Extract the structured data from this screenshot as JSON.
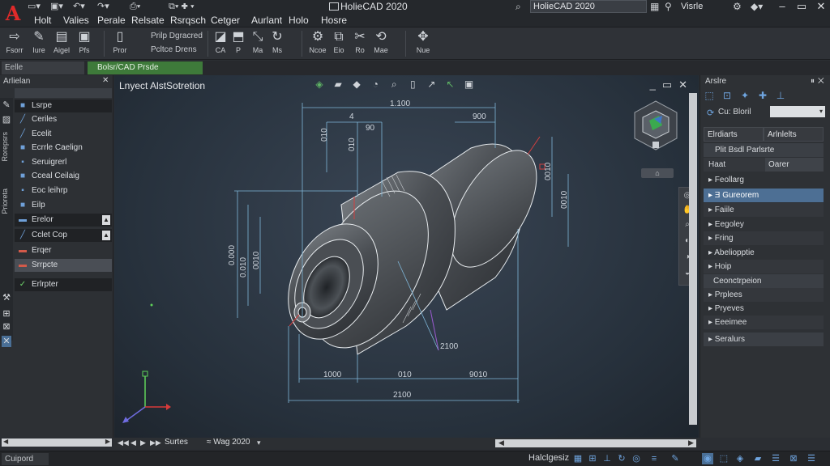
{
  "titlebar": {
    "window_title": "HolieCAD 2020",
    "search_value": "HolieCAD 2020",
    "account_label": "Visrle"
  },
  "menu": [
    "Holt",
    "Valies",
    "Perale",
    "Relsate",
    "Rsrqsch",
    "Cetger",
    "Aurlant",
    "Holo",
    "Hosre"
  ],
  "ribbon": {
    "buttons": [
      {
        "icon": "arrow-right-icon",
        "glyph": "⇨",
        "label": "Fsorr"
      },
      {
        "icon": "brush-icon",
        "glyph": "✎",
        "label": "Iure"
      },
      {
        "icon": "document-icon",
        "glyph": "▤",
        "label": "Aigel"
      },
      {
        "icon": "image-icon",
        "glyph": "▣",
        "label": "Pfs"
      },
      {
        "icon": "new-file-icon",
        "glyph": "▯",
        "label": "Pror"
      },
      {
        "icon": "shape-icon",
        "glyph": "◪",
        "label": "CA"
      },
      {
        "icon": "bookmark-icon",
        "glyph": "⬒",
        "label": "P"
      },
      {
        "icon": "arrows-icon",
        "glyph": "⤡",
        "label": "Ma"
      },
      {
        "icon": "rotate-icon",
        "glyph": "↻",
        "label": "Ms"
      },
      {
        "icon": "gear-icon",
        "glyph": "⚙",
        "label": "Ncoe"
      },
      {
        "icon": "copy-icon",
        "glyph": "⧉",
        "label": "Eio"
      },
      {
        "icon": "cut-icon",
        "glyph": "✂",
        "label": "Ro"
      },
      {
        "icon": "refresh-icon",
        "glyph": "⟲",
        "label": "Mae"
      },
      {
        "icon": "cursor-icon",
        "glyph": "✥",
        "label": "Nue"
      }
    ],
    "text_group_1": "Prilp Dgracred",
    "text_group_2": "Pcltce Drens"
  },
  "tabs": {
    "search": "Eelle",
    "document": "Bolsr/CAD Prsde"
  },
  "left_panel": {
    "title": "Arlielan",
    "vtab_1": "Rorepsrs",
    "vtab_2": "Prioreta",
    "items": [
      {
        "label": "Lsrpe",
        "icon": "line-icon",
        "glyph": "■",
        "style": "dark"
      },
      {
        "label": "Ceriles",
        "icon": "pen-icon",
        "glyph": "╱",
        "style": ""
      },
      {
        "label": "Ecelit",
        "icon": "pen-icon",
        "glyph": "╱",
        "style": ""
      },
      {
        "label": "Ecrrle Caelign",
        "icon": "square-icon",
        "glyph": "■",
        "style": ""
      },
      {
        "label": "Seruigrerl",
        "icon": "square-icon",
        "glyph": "▪",
        "style": ""
      },
      {
        "label": "Cceal Ceilaig",
        "icon": "square-icon",
        "glyph": "■",
        "style": ""
      },
      {
        "label": "Eoc leihrp",
        "icon": "square-icon",
        "glyph": "▪",
        "style": ""
      },
      {
        "label": "Eilp",
        "icon": "square-icon",
        "glyph": "■",
        "style": ""
      },
      {
        "label": "Erelor",
        "icon": "line-icon",
        "glyph": "▬",
        "style": "dark",
        "arrow": "▲"
      },
      {
        "label": "Cclet Cop",
        "icon": "pen-icon",
        "glyph": "╱",
        "style": "dark",
        "arrow": "▲"
      },
      {
        "label": "Erqer",
        "icon": "line-icon",
        "glyph": "▬",
        "style": ""
      },
      {
        "label": "Srrpcte",
        "icon": "line-icon",
        "glyph": "▬",
        "style": "sel"
      },
      {
        "label": "Erlrpter",
        "icon": "check-icon",
        "glyph": "✓",
        "style": "dark"
      }
    ]
  },
  "viewport": {
    "label": "Lnyect AlstSotretion",
    "dims": {
      "top_overall": "1.100",
      "left_small": "4",
      "gap_90": "90",
      "right_top": "900",
      "v_left_1": "010",
      "v_left_2": "010",
      "v_right_1": "0010",
      "v_right_2": "0010",
      "v_far_1": "0.000",
      "v_far_2": "0.010",
      "v_far_3": "0010",
      "b_1": "1000",
      "b_2": "010",
      "b_3": "9010",
      "b_total": "2100",
      "diag": "2100"
    },
    "viewcube_home": "⌂"
  },
  "bottombar": {
    "layout_label": "Surtes",
    "model_label": "≈ Wag 2020"
  },
  "right_panel": {
    "title": "Arslre",
    "combo_label": "Cu: Bloril",
    "tab_1": "Elrdiarts",
    "tab_2": "Arlnlelts",
    "rows": [
      {
        "label": "Plit Bsdl Parlsrte",
        "style": "hdr"
      },
      {
        "label": "Haat",
        "style": "alt",
        "value": "Oarer"
      },
      {
        "label": "▸ Feollarg",
        "style": ""
      },
      {
        "label": "▸ Ǝ Gureorem",
        "style": "sel"
      },
      {
        "label": "▸ Faiile",
        "style": "alt"
      },
      {
        "label": "▸ Eegoley",
        "style": ""
      },
      {
        "label": "▸ Fring",
        "style": "alt"
      },
      {
        "label": "▸ Abeliopptie",
        "style": ""
      },
      {
        "label": "▸ Hoip",
        "style": "alt"
      },
      {
        "label": "Ceonctrpeion",
        "style": "hdr"
      },
      {
        "label": "▸ Prplees",
        "style": "alt"
      },
      {
        "label": "▸ Pryeves",
        "style": ""
      },
      {
        "label": "▸ Eeeimee",
        "style": "alt"
      },
      {
        "label": "▸ Seralurs",
        "style": "hdr"
      }
    ]
  },
  "statusbar": {
    "cmd": "Cuipord",
    "model": "Halclgesiz"
  },
  "colors": {
    "accent_blue": "#4d6f94",
    "tab_green": "#3e7a3a",
    "logo_red": "#e02a2a",
    "model_line": "#e8ecef",
    "dim_line": "#7fb6d8"
  }
}
